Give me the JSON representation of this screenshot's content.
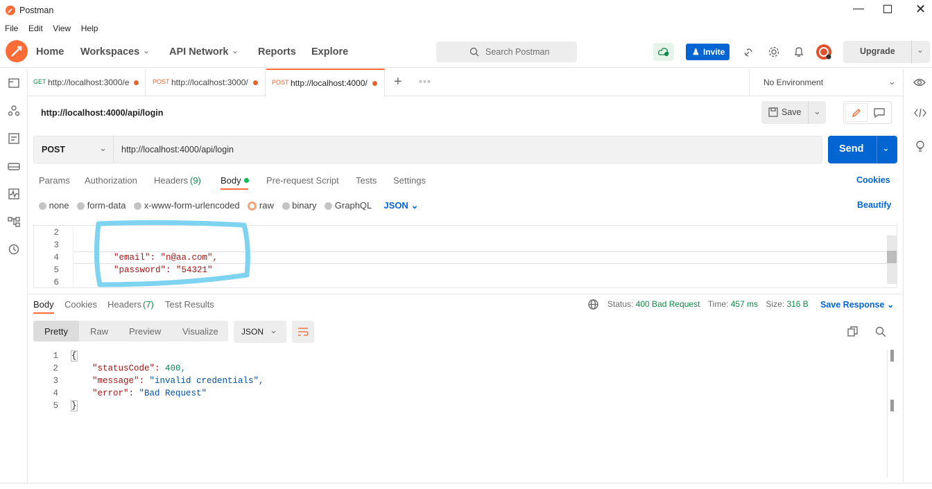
{
  "window": {
    "title": "Postman"
  },
  "menu": [
    "File",
    "Edit",
    "View",
    "Help"
  ],
  "header": {
    "nav": [
      "Home",
      "Workspaces",
      "API Network",
      "Reports",
      "Explore"
    ],
    "search_placeholder": "Search Postman",
    "invite_label": "Invite",
    "upgrade_label": "Upgrade"
  },
  "tabs": [
    {
      "method": "GET",
      "url": "http://localhost:3000/e"
    },
    {
      "method": "POST",
      "url": "http://localhost:3000/"
    },
    {
      "method": "POST",
      "url": "http://localhost:4000/"
    }
  ],
  "environment": "No Environment",
  "request": {
    "title": "http://localhost:4000/api/login",
    "save_label": "Save",
    "method": "POST",
    "url": "http://localhost:4000/api/login",
    "send_label": "Send",
    "subtabs": [
      "Params",
      "Authorization",
      "Headers",
      "(9)",
      "Body",
      "Pre-request Script",
      "Tests",
      "Settings"
    ],
    "cookies_label": "Cookies",
    "body_types": [
      "none",
      "form-data",
      "x-www-form-urlencoded",
      "raw",
      "binary",
      "GraphQL"
    ],
    "body_format": "JSON",
    "beautify_label": "Beautify",
    "body_lines": [
      {
        "n": "2",
        "text": ""
      },
      {
        "n": "3",
        "text": ""
      },
      {
        "n": "4",
        "text": "\"email\": \"n@aa.com\","
      },
      {
        "n": "5",
        "text": "\"password\": \"54321\""
      },
      {
        "n": "6",
        "text": ""
      }
    ]
  },
  "response": {
    "tabs": [
      "Body",
      "Cookies",
      "Headers",
      "(7)",
      "Test Results"
    ],
    "status_label": "Status:",
    "status_value": "400 Bad Request",
    "time_label": "Time:",
    "time_value": "457 ms",
    "size_label": "Size:",
    "size_value": "316 B",
    "save_response_label": "Save Response",
    "view_modes": [
      "Pretty",
      "Raw",
      "Preview",
      "Visualize"
    ],
    "format": "JSON",
    "lines": [
      {
        "n": "1",
        "key": "",
        "val": "{"
      },
      {
        "n": "2",
        "key": "\"statusCode\": ",
        "val": "400,"
      },
      {
        "n": "3",
        "key": "\"message\": ",
        "val": "\"invalid credentials\","
      },
      {
        "n": "4",
        "key": "\"error\": ",
        "val": "\"Bad Request\""
      },
      {
        "n": "5",
        "key": "",
        "val": "}"
      }
    ]
  },
  "colors": {
    "orange": "#ff6c37",
    "blue": "#0265d2",
    "green_status": "#0e8a4a",
    "highlight": "#7dd3f0"
  }
}
